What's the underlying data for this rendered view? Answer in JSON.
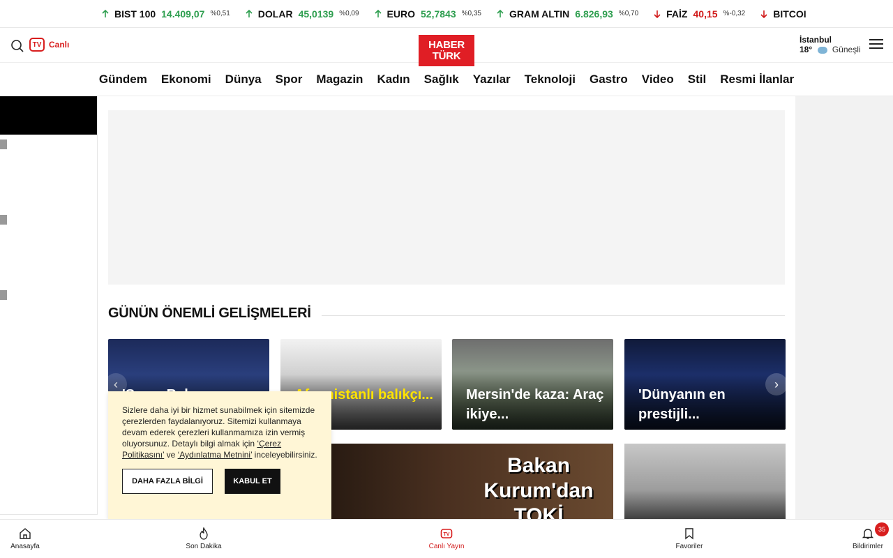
{
  "ticker": [
    {
      "name": "BIST 100",
      "value": "14.409,07",
      "pct": "%0,51",
      "trend": "up"
    },
    {
      "name": "DOLAR",
      "value": "45,0139",
      "pct": "%0,09",
      "trend": "up"
    },
    {
      "name": "EURO",
      "value": "52,7843",
      "pct": "%0,35",
      "trend": "up"
    },
    {
      "name": "GRAM ALTIN",
      "value": "6.826,93",
      "pct": "%0,70",
      "trend": "up"
    },
    {
      "name": "FAİZ",
      "value": "40,15",
      "pct": "%-0,32",
      "trend": "down"
    },
    {
      "name": "BITCOI",
      "value": "",
      "pct": "",
      "trend": "down"
    }
  ],
  "header": {
    "live_label": "Canlı",
    "tv_label": "TV",
    "logo_line1": "HABER",
    "logo_line2": "TÜRK",
    "weather_city": "İstanbul",
    "weather_temp": "18°",
    "weather_condition": "Güneşli"
  },
  "nav": [
    "Gündem",
    "Ekonomi",
    "Dünya",
    "Spor",
    "Magazin",
    "Kadın",
    "Sağlık",
    "Yazılar",
    "Teknoloji",
    "Gastro",
    "Video",
    "Stil",
    "Resmi İlanlar"
  ],
  "section_title": "GÜNÜN ÖNEMLİ GELİŞMELERİ",
  "cards": [
    {
      "caption": "'Sayın Bakan..."
    },
    {
      "caption": "Afganistanlı balıkçı..."
    },
    {
      "caption": "Mersin'de kaza: Araç ikiye..."
    },
    {
      "caption": "'Dünyanın en prestijli..."
    }
  ],
  "big_card_text": "Bakan Kurum'dan TOKİ",
  "cookie": {
    "text_before": "Sizlere daha iyi bir hizmet sunabilmek için sitemizde çerezlerden faydalanıyoruz. Sitemizi kullanmaya devam ederek çerezleri kullanmamıza izin vermiş oluyorsunuz. Detaylı bilgi almak için ",
    "link1": "‘Çerez Politikasını’",
    "text_mid": " ve ",
    "link2": "‘Aydınlatma Metnini’",
    "text_after": " inceleyebilirsiniz.",
    "more_button": "DAHA FAZLA BİLGİ",
    "accept_button": "KABUL ET"
  },
  "bottom_nav": [
    {
      "label": "Anasayfa"
    },
    {
      "label": "Son Dakika"
    },
    {
      "label": "Canlı Yayın"
    },
    {
      "label": "Favoriler"
    },
    {
      "label": "Bildirimler",
      "badge": "35"
    }
  ],
  "colors": {
    "brand": "#e01e25",
    "up": "#2e9e4f",
    "down": "#d11a1a",
    "cookie_bg": "#fff6d6"
  }
}
